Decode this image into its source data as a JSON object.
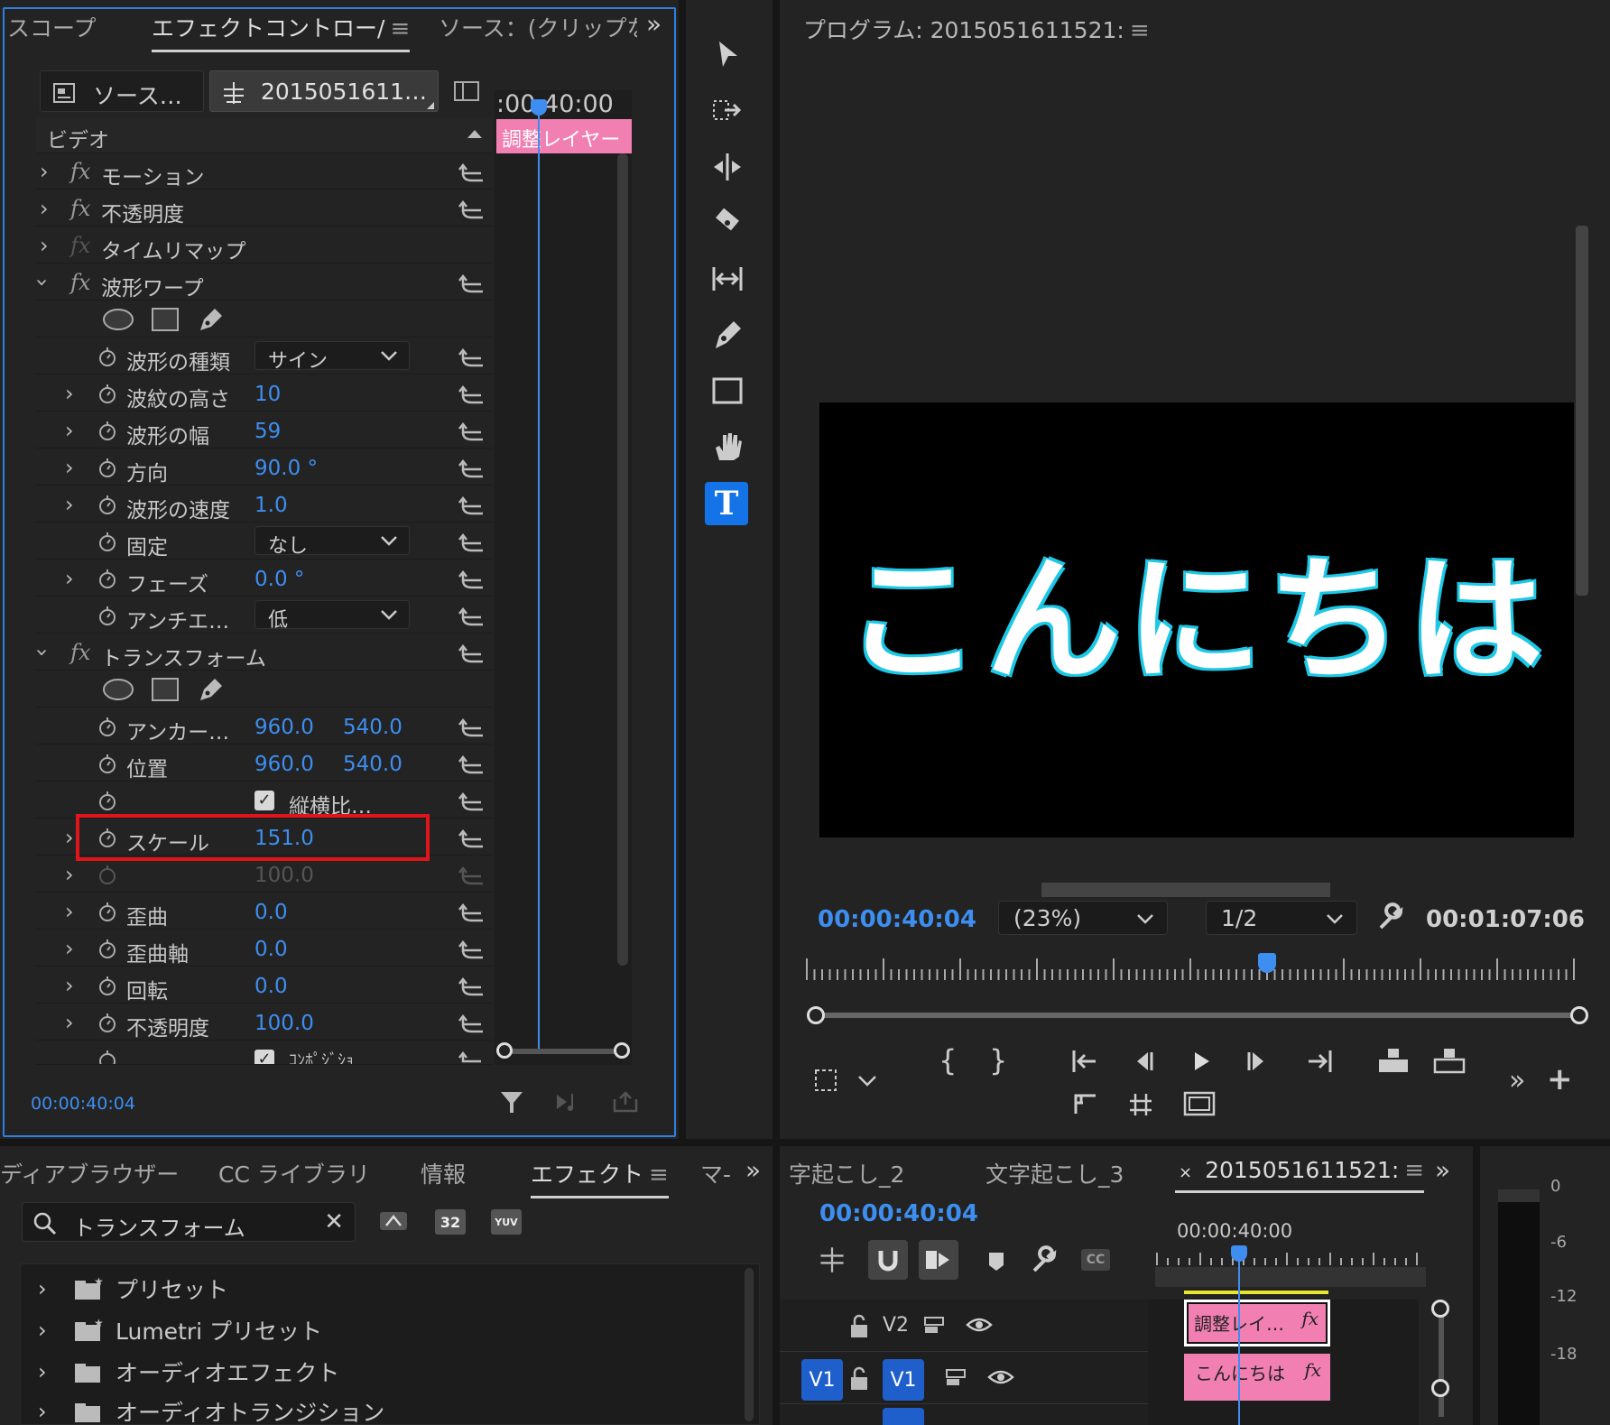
{
  "colors": {
    "accent": "#3d8ef0",
    "clip_pink": "#f17fb2",
    "highlight_red": "#e0141a",
    "text_cyan": "#1cc8e6"
  },
  "effect_panel": {
    "tabs": [
      "スコープ",
      "エフェクトコントロー/",
      "ソース：(クリップな"
    ],
    "source_tab": "ソース…",
    "clip_tab": "2015051611…",
    "timecode_ruler": ":00 40:00",
    "adjust_clip": "調整レイヤー",
    "video_header": "ビデオ",
    "rows": {
      "motion": "モーション",
      "opacity": "不透明度",
      "timeremap": "タイムリマップ",
      "wave": "波形ワープ",
      "wave_type": {
        "label": "波形の種類",
        "value": "サイン"
      },
      "wave_height": {
        "label": "波紋の高さ",
        "value": "10"
      },
      "wave_width": {
        "label": "波形の幅",
        "value": "59"
      },
      "direction": {
        "label": "方向",
        "value": "90.0 °"
      },
      "wave_speed": {
        "label": "波形の速度",
        "value": "1.0"
      },
      "pin": {
        "label": "固定",
        "value": "なし"
      },
      "phase": {
        "label": "フェーズ",
        "value": "0.0 °"
      },
      "antialias": {
        "label": "アンチエ…",
        "value": "低"
      },
      "transform": "トランスフォーム",
      "anchor": {
        "label": "アンカー…",
        "x": "960.0",
        "y": "540.0"
      },
      "position": {
        "label": "位置",
        "x": "960.0",
        "y": "540.0"
      },
      "aspect": "縦横比…",
      "scale": {
        "label": "スケール",
        "value": "151.0"
      },
      "scale_w": {
        "value": "100.0"
      },
      "skew": {
        "label": "歪曲",
        "value": "0.0"
      },
      "skew_axis": {
        "label": "歪曲軸",
        "value": "0.0"
      },
      "rotation": {
        "label": "回転",
        "value": "0.0"
      },
      "opacity2": {
        "label": "不透明度",
        "value": "100.0"
      },
      "composite": "ｺﾝﾎﾟｼﾞｼｮ"
    },
    "timecode": "00:00:40:04"
  },
  "program": {
    "title": "プログラム: 2015051611521:",
    "overlay_text": "こんにちは",
    "timecode": "00:00:40:04",
    "zoom": "(23%)",
    "resolution": "1/2",
    "duration": "00:01:07:06"
  },
  "project": {
    "tabs": [
      "ディアブラウザー",
      "CC ライブラリ",
      "情報",
      "エフェクト",
      "マ-"
    ],
    "search_value": "トランスフォーム",
    "badges": [
      "32",
      "YUV"
    ],
    "items": [
      "プリセット",
      "Lumetri プリセット",
      "オーディオエフェクト",
      "オーディオトランジション"
    ]
  },
  "timeline": {
    "tabs": [
      "字起こし_2",
      "文字起こし_3",
      "2015051611521:"
    ],
    "close": "×",
    "timecode": "00:00:40:04",
    "ruler_time": "00:00:40:00",
    "tracks": {
      "v2": "V2",
      "v1": "V1",
      "v1_src": "V1"
    },
    "clips": {
      "adjust": "調整レイ…",
      "text": "こんにちは",
      "fx": "fx"
    }
  },
  "meter": {
    "labels": [
      "0",
      "-6",
      "-12",
      "-18"
    ]
  }
}
